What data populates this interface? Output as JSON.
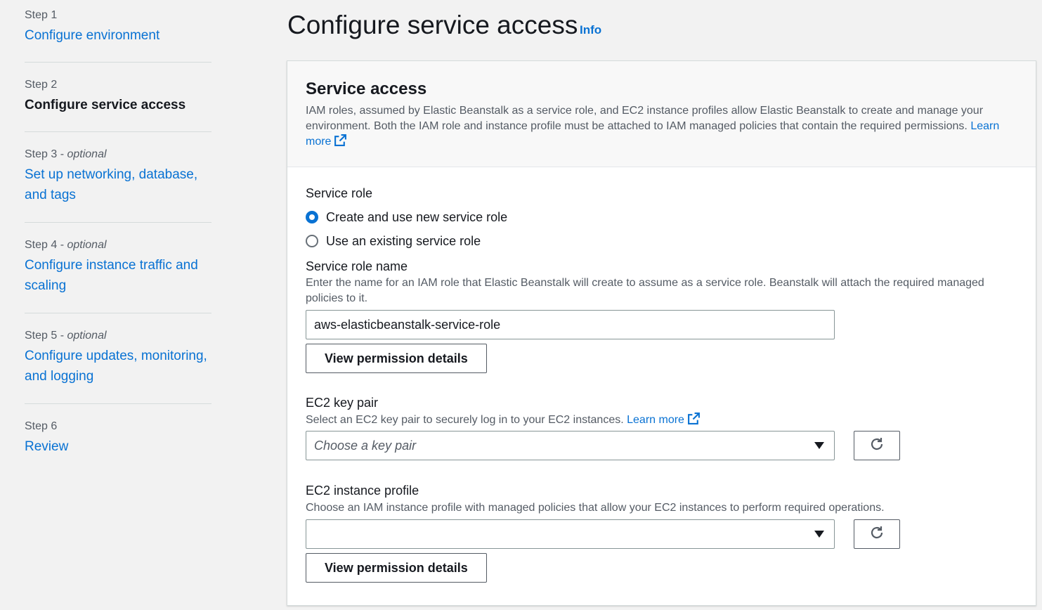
{
  "sidebar": {
    "steps": [
      {
        "num": "Step 1",
        "optional": "",
        "title": "Configure environment"
      },
      {
        "num": "Step 2",
        "optional": "",
        "title": "Configure service access"
      },
      {
        "num": "Step 3",
        "optional": "optional",
        "title": "Set up networking, database, and tags"
      },
      {
        "num": "Step 4",
        "optional": "optional",
        "title": "Configure instance traffic and scaling"
      },
      {
        "num": "Step 5",
        "optional": "optional",
        "title": "Configure updates, monitoring, and logging"
      },
      {
        "num": "Step 6",
        "optional": "",
        "title": "Review"
      }
    ],
    "optional_separator": " - "
  },
  "page": {
    "title": "Configure service access",
    "info_link": "Info"
  },
  "service_access": {
    "title": "Service access",
    "description": "IAM roles, assumed by Elastic Beanstalk as a service role, and EC2 instance profiles allow Elastic Beanstalk to create and manage your environment. Both the IAM role and instance profile must be attached to IAM managed policies that contain the required permissions.",
    "learn_more": "Learn more"
  },
  "service_role": {
    "label": "Service role",
    "options": [
      {
        "label": "Create and use new service role",
        "checked": true
      },
      {
        "label": "Use an existing service role",
        "checked": false
      }
    ],
    "name_label": "Service role name",
    "name_description": "Enter the name for an IAM role that Elastic Beanstalk will create to assume as a service role. Beanstalk will attach the required managed policies to it.",
    "name_value": "aws-elasticbeanstalk-service-role",
    "view_permissions": "View permission details"
  },
  "ec2_key_pair": {
    "label": "EC2 key pair",
    "description": "Select an EC2 key pair to securely log in to your EC2 instances.",
    "learn_more": "Learn more",
    "placeholder": "Choose a key pair"
  },
  "ec2_instance_profile": {
    "label": "EC2 instance profile",
    "description": "Choose an IAM instance profile with managed policies that allow your EC2 instances to perform required operations.",
    "value": "",
    "view_permissions": "View permission details"
  },
  "colors": {
    "link": "#0972d3",
    "text": "#16191f",
    "muted": "#545b64",
    "background": "#f2f2f2"
  }
}
